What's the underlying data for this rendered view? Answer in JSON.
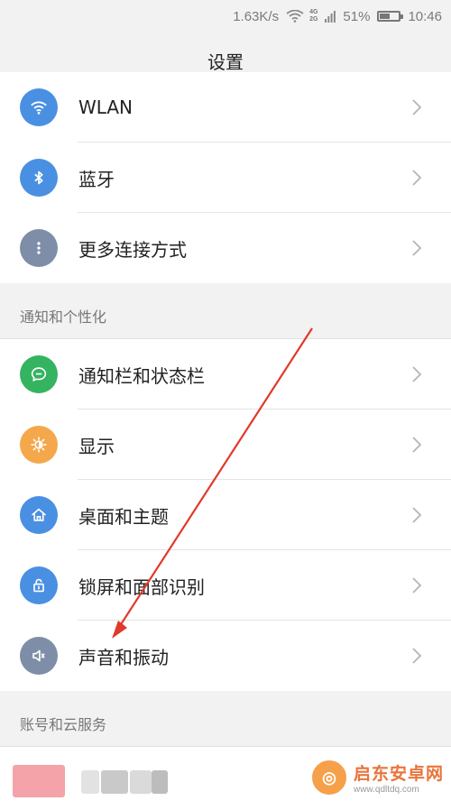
{
  "status_bar": {
    "speed": "1.63K/s",
    "net_4g": "4G",
    "net_2g": "2G",
    "battery": "51%",
    "battery_level": 0.51,
    "time": "10:46"
  },
  "header": {
    "title": "设置"
  },
  "connections": {
    "items": [
      {
        "label": "WLAN",
        "icon": "wifi-icon",
        "color": "#4a90e2"
      },
      {
        "label": "蓝牙",
        "icon": "bluetooth-icon",
        "color": "#4a90e2"
      },
      {
        "label": "更多连接方式",
        "icon": "more-dots-icon",
        "color": "#7e8ea8"
      }
    ]
  },
  "personalization": {
    "header": "通知和个性化",
    "items": [
      {
        "label": "通知栏和状态栏",
        "icon": "chat-bubble-icon",
        "color": "#34b360"
      },
      {
        "label": "显示",
        "icon": "brightness-icon",
        "color": "#f5a84b"
      },
      {
        "label": "桌面和主题",
        "icon": "home-icon",
        "color": "#4a90e2"
      },
      {
        "label": "锁屏和面部识别",
        "icon": "lock-icon",
        "color": "#4a90e2"
      },
      {
        "label": "声音和振动",
        "icon": "speaker-icon",
        "color": "#7e8ea8"
      }
    ]
  },
  "account": {
    "header": "账号和云服务"
  },
  "watermark": {
    "title": "启东安卓网",
    "url": "www.qdltdq.com"
  },
  "colors": {
    "arrow": "#e03a2a"
  }
}
